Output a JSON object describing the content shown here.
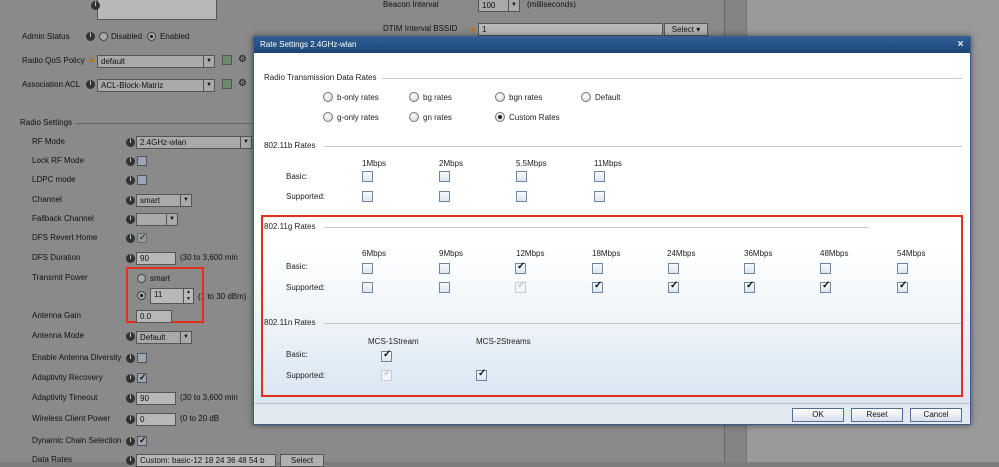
{
  "background": {
    "beacon_interval_label": "Beacon Interval",
    "beacon_interval_value": "100",
    "beacon_interval_unit": "(milliseconds)",
    "dtim_label": "DTIM Interval BSSID",
    "dtim_value": "1",
    "dtim_select": "Select",
    "admin_status_label": "Admin Status",
    "admin_disabled": "Disabled",
    "admin_enabled": "Enabled",
    "qos_label": "Radio QoS Policy",
    "qos_value": "default",
    "acl_label": "Association ACL",
    "acl_value": "ACL-Block-Matriz",
    "radio_settings": "Radio Settings",
    "rf_mode_label": "RF Mode",
    "rf_mode_value": "2.4GHz-wlan",
    "lock_rf_label": "Lock RF Mode",
    "ldpc_label": "LDPC mode",
    "channel_label": "Channel",
    "channel_value": "smart",
    "fallback_label": "Fallback Channel",
    "dfs_revert_label": "DFS Revert Home",
    "dfs_duration_label": "DFS Duration",
    "dfs_duration_value": "90",
    "dfs_duration_unit": "(30 to 3,600 min",
    "tx_power_label": "Transmit Power",
    "tx_smart": "smart",
    "tx_value": "11",
    "tx_unit": "(1 to 30 dBm)",
    "antenna_gain_label": "Antenna Gain",
    "antenna_gain_value": "0.0",
    "antenna_mode_label": "Antenna Mode",
    "antenna_mode_value": "Default",
    "antenna_div_label": "Enable Antenna Diversity",
    "adapt_recovery_label": "Adaptivity Recovery",
    "adapt_timeout_label": "Adaptivity Timeout",
    "adapt_timeout_value": "90",
    "adapt_timeout_unit": "(30 to 3,600 min",
    "wc_power_label": "Wireless Client Power",
    "wc_power_value": "0",
    "wc_power_unit": "(0 to 20 dB",
    "dyn_chain_label": "Dynamic Chain Selection",
    "data_rates_label": "Data Rates",
    "data_rates_value": "Custom: basic-12 18 24 36 48 54 b",
    "data_rates_select": "Select"
  },
  "modal": {
    "title": "Rate Settings 2.4GHz-wlan",
    "close": "×",
    "tx_section": "Radio Transmission Data Rates",
    "rate_options": [
      {
        "label": "b-only rates",
        "selected": false
      },
      {
        "label": "bg rates",
        "selected": false
      },
      {
        "label": "bgn rates",
        "selected": false
      },
      {
        "label": "Default",
        "selected": false
      },
      {
        "label": "g-only rates",
        "selected": false
      },
      {
        "label": "gn rates",
        "selected": false
      },
      {
        "label": "Custom Rates",
        "selected": true
      }
    ],
    "b_section": "802.11b Rates",
    "b_rates": [
      "1Mbps",
      "2Mbps",
      "5.5Mbps",
      "11Mbps"
    ],
    "g_section": "802.11g Rates",
    "g_rates": [
      "6Mbps",
      "9Mbps",
      "12Mbps",
      "18Mbps",
      "24Mbps",
      "36Mbps",
      "48Mbps",
      "54Mbps"
    ],
    "n_section": "802.11n Rates",
    "n_rates": [
      "MCS-1Stream",
      "MCS-2Streams"
    ],
    "basic_label": "Basic:",
    "supported_label": "Supported:",
    "ok": "OK",
    "reset": "Reset",
    "cancel": "Cancel"
  },
  "colors": {
    "title_bar": "#1c4474",
    "highlight_box": "#e2301e"
  }
}
